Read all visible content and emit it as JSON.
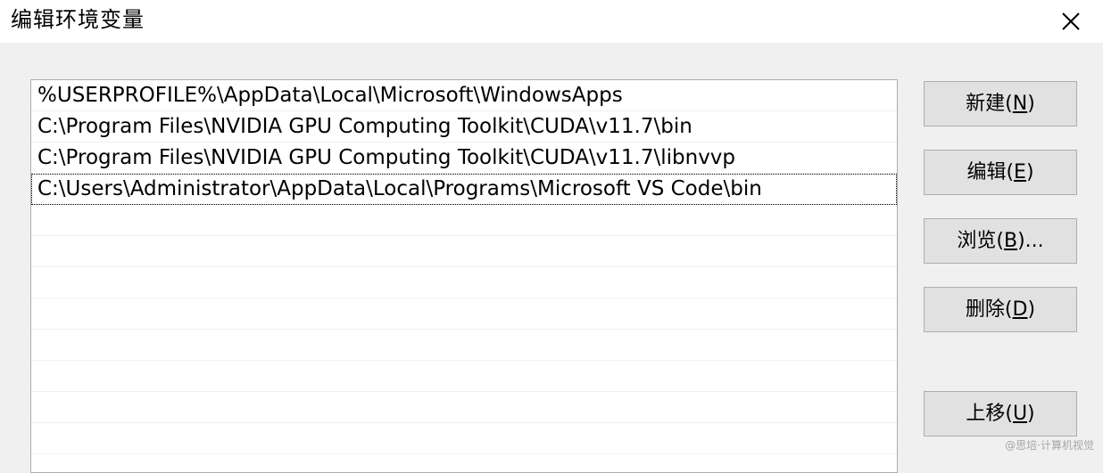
{
  "window": {
    "title": "编辑环境变量",
    "close_icon": "close-icon"
  },
  "list": {
    "items": [
      "%USERPROFILE%\\AppData\\Local\\Microsoft\\WindowsApps",
      "C:\\Program Files\\NVIDIA GPU Computing Toolkit\\CUDA\\v11.7\\bin",
      "C:\\Program Files\\NVIDIA GPU Computing Toolkit\\CUDA\\v11.7\\libnvvp",
      "C:\\Users\\Administrator\\AppData\\Local\\Programs\\Microsoft VS Code\\bin"
    ]
  },
  "buttons": {
    "new": {
      "label": "新建(",
      "hotkey": "N",
      "suffix": ")"
    },
    "edit": {
      "label": "编辑(",
      "hotkey": "E",
      "suffix": ")"
    },
    "browse": {
      "label": "浏览(",
      "hotkey": "B",
      "suffix": ")..."
    },
    "delete": {
      "label": "删除(",
      "hotkey": "D",
      "suffix": ")"
    },
    "move_up": {
      "label": "上移(",
      "hotkey": "U",
      "suffix": ")"
    }
  },
  "watermark": "@思培·计算机视觉",
  "colors": {
    "background": "#f0f0f0",
    "titlebar": "#ffffff",
    "button_face": "#e1e1e1",
    "border": "#adadad"
  }
}
